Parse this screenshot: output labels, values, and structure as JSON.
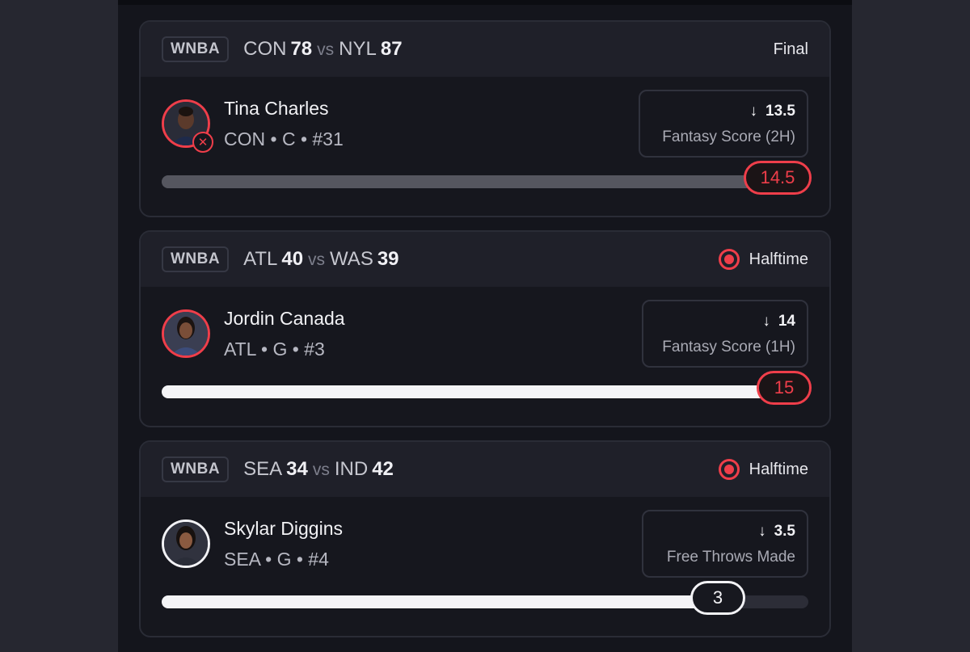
{
  "cards": [
    {
      "league": "WNBA",
      "away_team": "CON",
      "away_score": "78",
      "vs": "vs",
      "home_team": "NYL",
      "home_score": "87",
      "status": "Final",
      "player_name": "Tina Charles",
      "player_meta": "CON • C • #31",
      "prop_arrow": "↓",
      "prop_line": "13.5",
      "prop_stat": "Fantasy Score (2H)",
      "actual": "14.5",
      "progress": 1.0
    },
    {
      "league": "WNBA",
      "away_team": "ATL",
      "away_score": "40",
      "vs": "vs",
      "home_team": "WAS",
      "home_score": "39",
      "status": "Halftime",
      "player_name": "Jordin Canada",
      "player_meta": "ATL • G • #3",
      "prop_arrow": "↓",
      "prop_line": "14",
      "prop_stat": "Fantasy Score (1H)",
      "actual": "15",
      "progress": 1.0
    },
    {
      "league": "WNBA",
      "away_team": "SEA",
      "away_score": "34",
      "vs": "vs",
      "home_team": "IND",
      "home_score": "42",
      "status": "Halftime",
      "player_name": "Skylar Diggins",
      "player_meta": "SEA • G • #4",
      "prop_arrow": "↓",
      "prop_line": "3.5",
      "prop_stat": "Free Throws Made",
      "actual": "3",
      "progress": 0.857
    }
  ],
  "colors": {
    "accent_red": "#ef3e4a",
    "panel_bg": "#14151c",
    "header_bg": "#1f2029"
  }
}
